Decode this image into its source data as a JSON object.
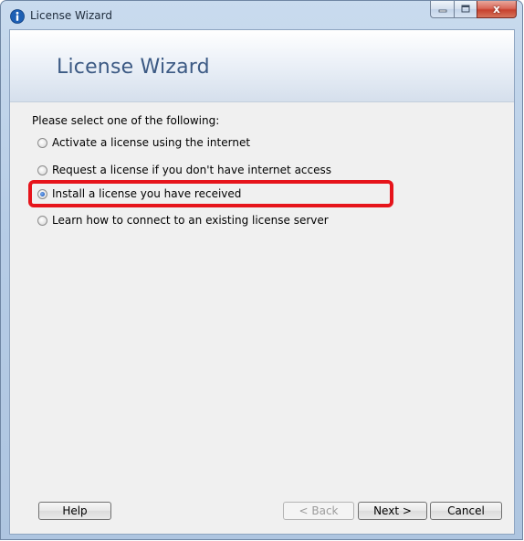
{
  "window": {
    "title": "License Wizard",
    "icon": "info-icon"
  },
  "caption_buttons": {
    "minimize_icon": "minimize-icon",
    "maximize_icon": "maximize-icon",
    "close_label": "x"
  },
  "banner": {
    "title": "License Wizard"
  },
  "prompt": "Please select one of the following:",
  "options": [
    {
      "label": "Activate a license using the internet",
      "checked": false
    },
    {
      "label": "Request a license if you don't have internet access",
      "checked": false
    },
    {
      "label": "Install a license you have received",
      "checked": true
    },
    {
      "label": "Learn how to connect to an existing license server",
      "checked": false
    }
  ],
  "buttons": {
    "help": "Help",
    "back": "< Back",
    "next": "Next >",
    "cancel": "Cancel"
  },
  "colors": {
    "highlight": "#e6141b",
    "banner_title": "#3c5a84"
  }
}
